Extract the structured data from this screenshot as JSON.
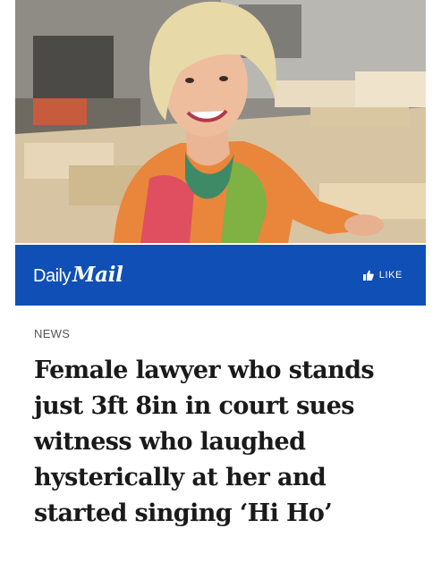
{
  "photo": {
    "alt": ""
  },
  "brand": {
    "word1": "Daily",
    "word2": "Mail"
  },
  "like": {
    "label": "LIKE"
  },
  "article": {
    "section": "NEWS",
    "headline": "Female lawyer who stands just 3ft 8in in court sues witness who laughed hysterically at her and started singing ‘Hi Ho’"
  },
  "colors": {
    "bar": "#0f4fb6",
    "text": "#1a1a1a",
    "section": "#555555"
  }
}
